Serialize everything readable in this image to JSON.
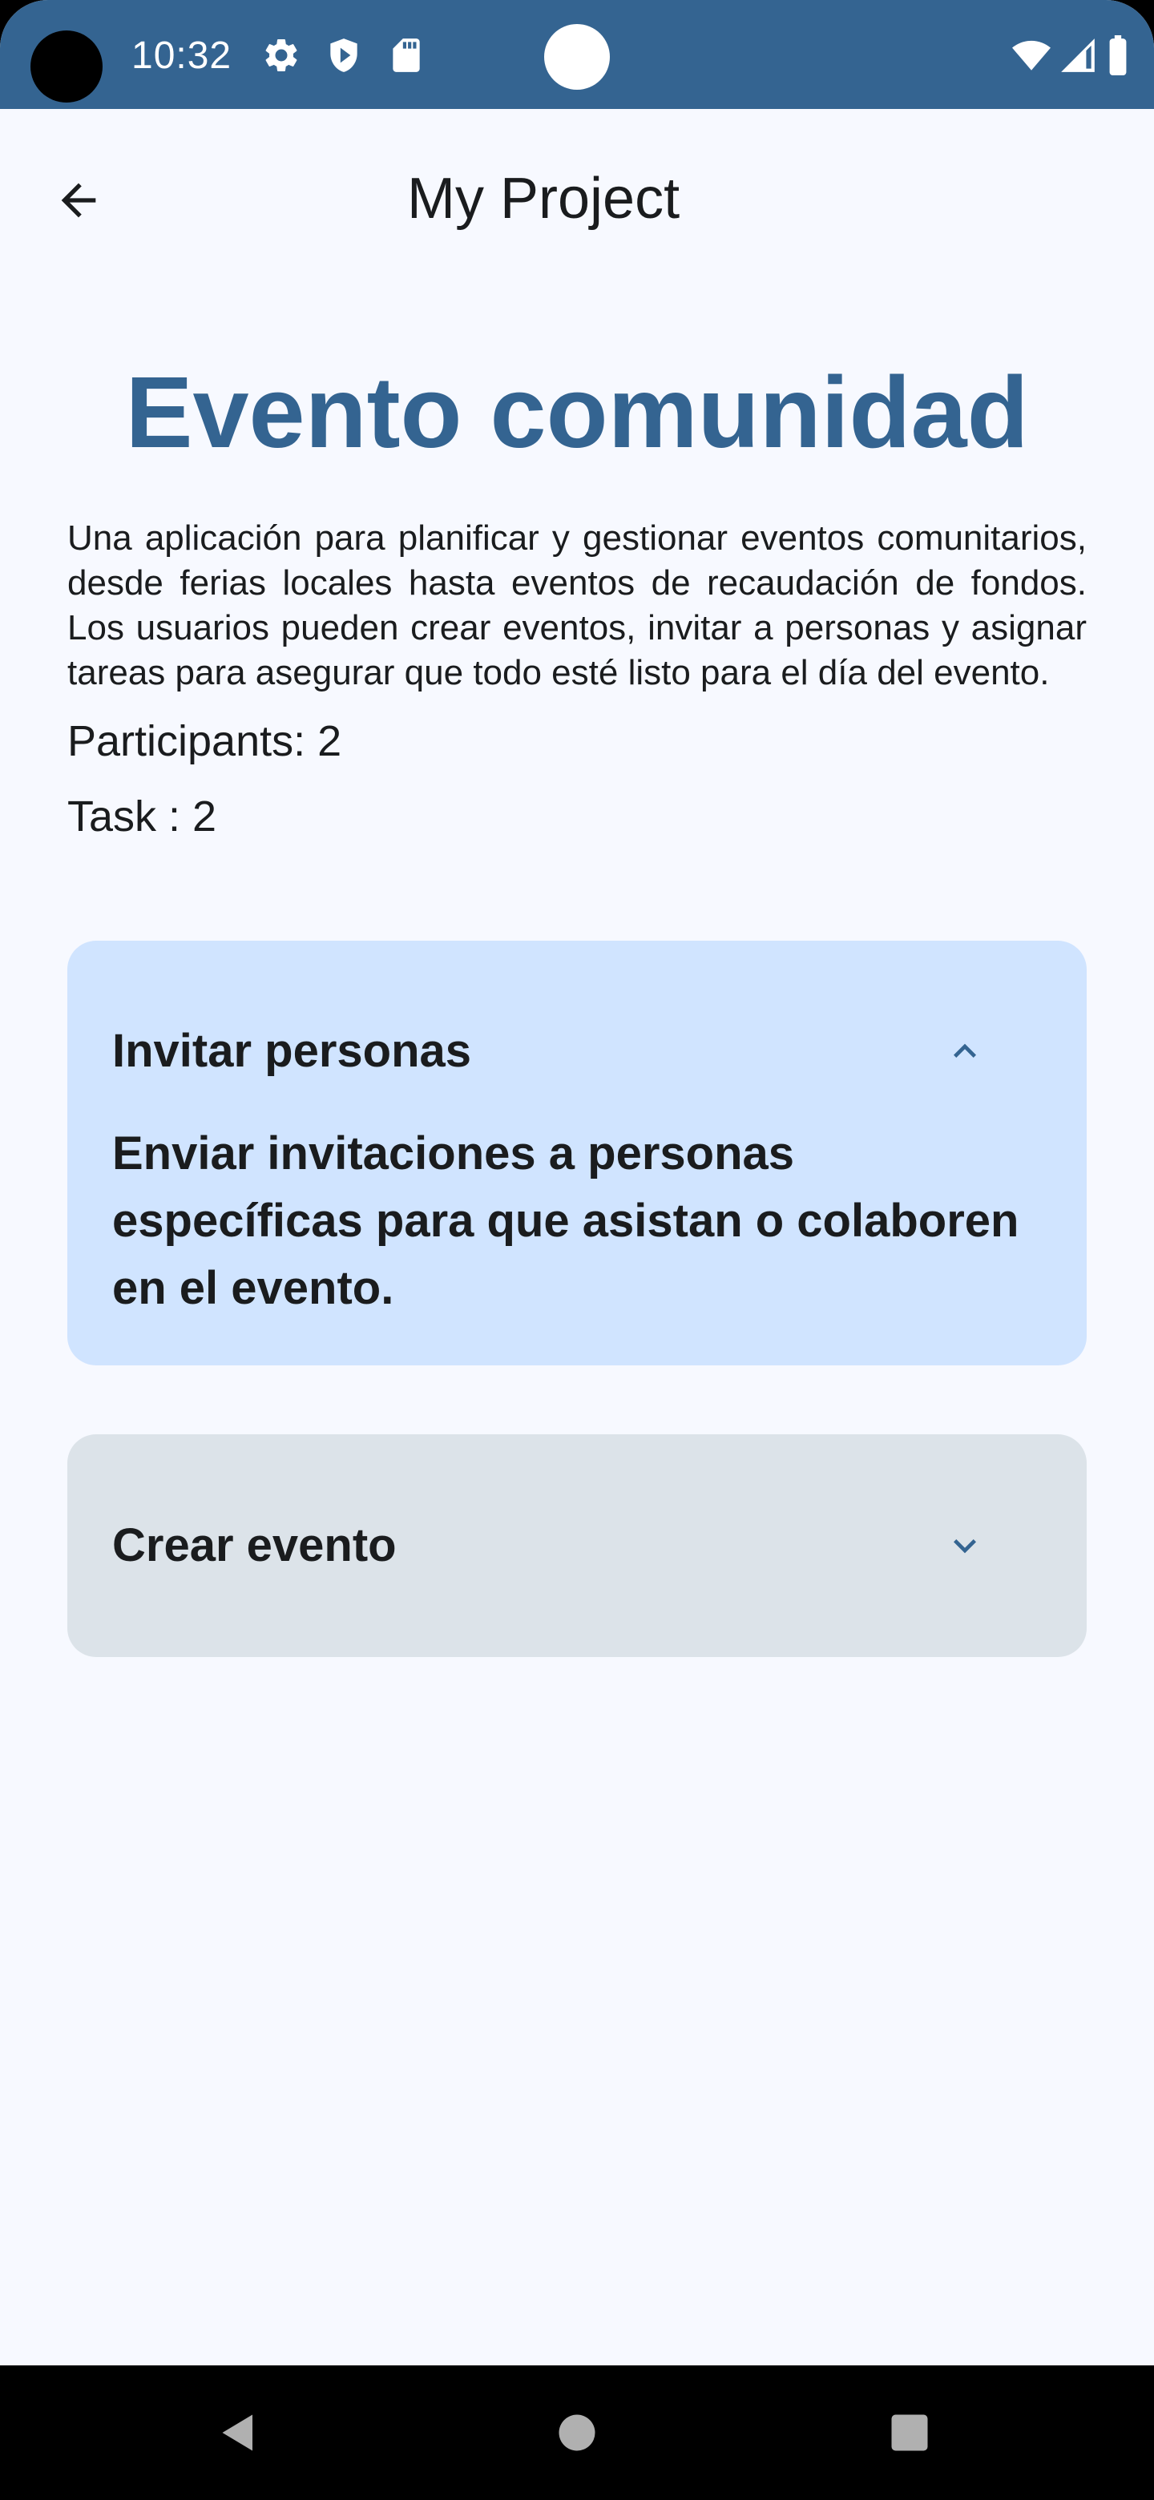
{
  "status_bar": {
    "time": "10:32",
    "color": "#346491",
    "left_icons": [
      "settings-icon",
      "shield-icon",
      "sd-card-icon"
    ],
    "right_icons": [
      "wifi-icon",
      "signal-icon",
      "battery-icon"
    ]
  },
  "app_bar": {
    "title": "My Project",
    "back_icon": "arrow-back-icon"
  },
  "event": {
    "title": "Evento comunidad",
    "description": "Una aplicación para planificar y gestionar eventos comunitarios, desde ferias locales hasta eventos de recaudación de fondos. Los usuarios pueden crear eventos, invitar a personas y asignar tareas para asegurar que todo esté listo para el día del evento.",
    "participants_label": "Participants: 2",
    "tasks_label": "Task : 2",
    "title_color": "#346491"
  },
  "tasks": [
    {
      "title": "Invitar personas",
      "description": "Enviar invitaciones a personas específicas para que asistan o colaboren en el evento.",
      "expanded": true,
      "background": "#d0e4ff",
      "icon": "chevron-up-icon"
    },
    {
      "title": "Crear evento",
      "expanded": false,
      "background": "#dce3e9",
      "icon": "chevron-down-icon"
    }
  ],
  "nav_bar": {
    "buttons": [
      "nav-back-icon",
      "nav-home-icon",
      "nav-recents-icon"
    ]
  }
}
